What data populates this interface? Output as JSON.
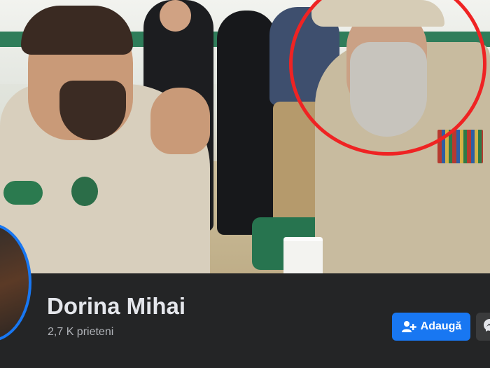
{
  "profile": {
    "name": "Dorina Mihai",
    "friends_count": "2,7 K prieteni"
  },
  "actions": {
    "add_label": "Adaugă",
    "add_icon": "add-friend-icon",
    "message_icon": "messenger-icon"
  },
  "colors": {
    "accent": "#1877f2",
    "highlight_circle": "#ef2323",
    "background": "#242526",
    "name_text": "#e4e6eb",
    "secondary_text": "#b0b3b8"
  }
}
